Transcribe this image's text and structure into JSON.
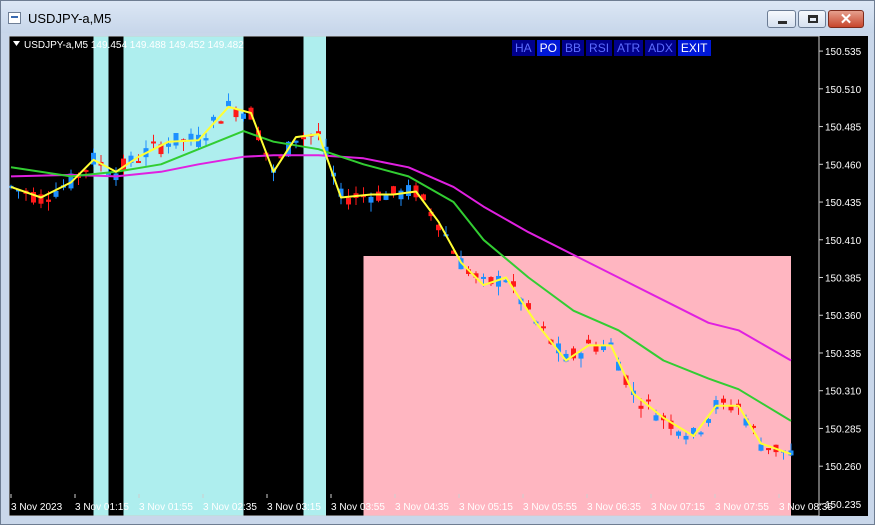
{
  "window": {
    "title": "USDJPY-a,M5",
    "buttons": {
      "minimize": "minimize",
      "maximize": "maximize",
      "close": "✕"
    }
  },
  "chart": {
    "symbol_info": "USDJPY-a,M5  149.454 149.488 149.452 149.482",
    "background": "#000000",
    "grid": false,
    "price_axis": [
      "150.535",
      "150.510",
      "150.485",
      "150.460",
      "150.435",
      "150.410",
      "150.385",
      "150.360",
      "150.335",
      "150.310",
      "150.285",
      "150.260",
      "150.235"
    ],
    "time_axis": [
      "3 Nov 2023",
      "3 Nov 01:15",
      "3 Nov 01:55",
      "3 Nov 02:35",
      "3 Nov 03:15",
      "3 Nov 03:55",
      "3 Nov 04:35",
      "3 Nov 05:15",
      "3 Nov 05:55",
      "3 Nov 06:35",
      "3 Nov 07:15",
      "3 Nov 07:55",
      "3 Nov 08:35"
    ],
    "menu": [
      {
        "label": "HA",
        "active": false
      },
      {
        "label": "PO",
        "active": true
      },
      {
        "label": "BB",
        "active": false
      },
      {
        "label": "RSI",
        "active": false
      },
      {
        "label": "ATR",
        "active": false
      },
      {
        "label": "ADX",
        "active": false
      },
      {
        "label": "EXIT",
        "active": true
      }
    ],
    "colors": {
      "bull_candle": "#1e90ff",
      "bear_candle": "#ff1a1a",
      "ma_fast": "#ffff33",
      "ma_mid": "#32cd32",
      "ma_slow": "#e020e0",
      "bull_zone": "#aeeeee",
      "bear_zone": "#ffb6c1"
    }
  },
  "chart_data": {
    "type": "candlestick",
    "symbol": "USDJPY-a",
    "timeframe": "M5",
    "ylim": [
      150.227,
      150.545
    ],
    "bull_zones": [
      [
        "3 Nov 00:55",
        "3 Nov 01:05"
      ],
      [
        "3 Nov 01:15",
        "3 Nov 02:35"
      ],
      [
        "3 Nov 03:15",
        "3 Nov 03:30"
      ]
    ],
    "bear_zones": [
      [
        "3 Nov 03:55",
        "3 Nov 08:40"
      ]
    ],
    "series": [
      {
        "name": "ma_fast",
        "color": "#ffff33",
        "x": [
          "00:00",
          "00:20",
          "00:40",
          "00:55",
          "01:10",
          "01:25",
          "01:45",
          "02:05",
          "02:25",
          "02:40",
          "02:55",
          "03:10",
          "03:25",
          "03:40",
          "04:00",
          "04:15",
          "04:30",
          "04:45",
          "05:00",
          "05:15",
          "05:30",
          "05:50",
          "06:10",
          "06:25",
          "06:40",
          "06:55",
          "07:15",
          "07:35",
          "07:50",
          "08:05",
          "08:20",
          "08:40"
        ],
        "y": [
          150.445,
          150.438,
          150.448,
          150.463,
          150.455,
          150.465,
          150.475,
          150.476,
          150.498,
          150.494,
          150.455,
          150.478,
          150.48,
          150.438,
          150.44,
          150.44,
          150.442,
          150.422,
          150.395,
          150.38,
          150.385,
          150.355,
          150.33,
          150.34,
          150.34,
          150.308,
          150.292,
          150.28,
          150.3,
          150.3,
          150.275,
          150.268
        ]
      },
      {
        "name": "ma_mid",
        "color": "#32cd32",
        "x": [
          "00:00",
          "00:40",
          "01:10",
          "01:40",
          "02:05",
          "02:35",
          "02:55",
          "03:25",
          "03:55",
          "04:25",
          "04:55",
          "05:15",
          "05:45",
          "06:15",
          "06:45",
          "07:15",
          "07:45",
          "08:05",
          "08:40"
        ],
        "y": [
          150.458,
          150.452,
          150.455,
          150.46,
          150.47,
          150.482,
          150.475,
          150.47,
          150.46,
          150.452,
          150.435,
          150.41,
          150.385,
          150.363,
          150.35,
          150.33,
          150.318,
          150.311,
          150.29
        ]
      },
      {
        "name": "ma_slow",
        "color": "#e020e0",
        "x": [
          "00:00",
          "00:40",
          "01:10",
          "01:40",
          "02:05",
          "02:35",
          "02:55",
          "03:25",
          "03:55",
          "04:25",
          "04:55",
          "05:15",
          "05:45",
          "06:15",
          "06:45",
          "07:15",
          "07:45",
          "08:05",
          "08:40"
        ],
        "y": [
          150.452,
          150.453,
          150.452,
          150.455,
          150.46,
          150.465,
          150.466,
          150.466,
          150.464,
          150.458,
          150.445,
          150.432,
          150.415,
          150.4,
          150.385,
          150.37,
          150.355,
          150.35,
          150.33
        ]
      }
    ]
  }
}
